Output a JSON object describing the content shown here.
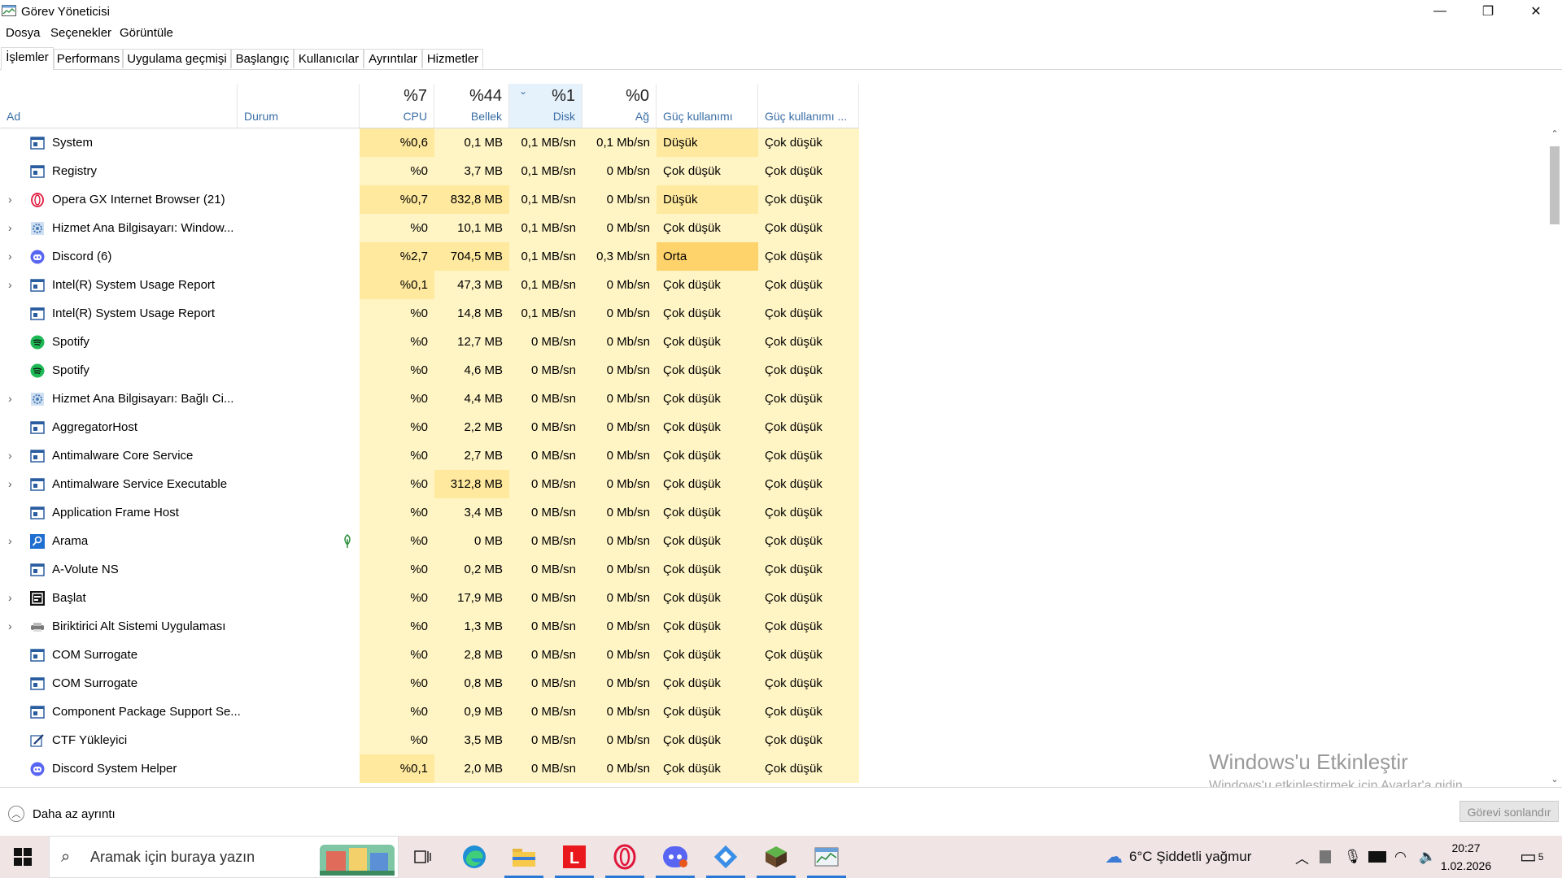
{
  "window": {
    "title": "Görev Yöneticisi",
    "controls": {
      "minimize": "—",
      "restore": "❐",
      "close": "✕"
    }
  },
  "menu": [
    "Dosya",
    "Seçenekler",
    "Görüntüle"
  ],
  "tabs": [
    "İşlemler",
    "Performans",
    "Uygulama geçmişi",
    "Başlangıç",
    "Kullanıcılar",
    "Ayrıntılar",
    "Hizmetler"
  ],
  "active_tab": "İşlemler",
  "columns": {
    "name": "Ad",
    "status": "Durum",
    "cpu": {
      "pct": "%7",
      "label": "CPU"
    },
    "memory": {
      "pct": "%44",
      "label": "Bellek"
    },
    "disk": {
      "pct": "%1",
      "label": "Disk"
    },
    "network": {
      "pct": "%0",
      "label": "Ağ"
    },
    "power": "Güç kullanımı",
    "power_trend": "Güç kullanımı ..."
  },
  "processes": [
    {
      "name": "System",
      "icon": "app-window-icon",
      "expandable": false,
      "cpu": "%0,6",
      "memory": "0,1 MB",
      "disk": "0,1 MB/sn",
      "network": "0,1 Mb/sn",
      "power": "Düşük",
      "power_trend": "Çok düşük"
    },
    {
      "name": "Registry",
      "icon": "app-window-icon",
      "expandable": false,
      "cpu": "%0",
      "memory": "3,7 MB",
      "disk": "0,1 MB/sn",
      "network": "0 Mb/sn",
      "power": "Çok düşük",
      "power_trend": "Çok düşük"
    },
    {
      "name": "Opera GX Internet Browser (21)",
      "icon": "opera-icon",
      "expandable": true,
      "cpu": "%0,7",
      "memory": "832,8 MB",
      "disk": "0,1 MB/sn",
      "network": "0 Mb/sn",
      "power": "Düşük",
      "power_trend": "Çok düşük"
    },
    {
      "name": "Hizmet Ana Bilgisayarı: Window...",
      "icon": "gear-icon",
      "expandable": true,
      "cpu": "%0",
      "memory": "10,1 MB",
      "disk": "0,1 MB/sn",
      "network": "0 Mb/sn",
      "power": "Çok düşük",
      "power_trend": "Çok düşük"
    },
    {
      "name": "Discord (6)",
      "icon": "discord-icon",
      "expandable": true,
      "cpu": "%2,7",
      "memory": "704,5 MB",
      "disk": "0,1 MB/sn",
      "network": "0,3 Mb/sn",
      "power": "Orta",
      "power_trend": "Çok düşük"
    },
    {
      "name": "Intel(R) System Usage Report",
      "icon": "app-window-icon",
      "expandable": true,
      "cpu": "%0,1",
      "memory": "47,3 MB",
      "disk": "0,1 MB/sn",
      "network": "0 Mb/sn",
      "power": "Çok düşük",
      "power_trend": "Çok düşük"
    },
    {
      "name": "Intel(R) System Usage Report",
      "icon": "app-window-icon",
      "expandable": false,
      "cpu": "%0",
      "memory": "14,8 MB",
      "disk": "0,1 MB/sn",
      "network": "0 Mb/sn",
      "power": "Çok düşük",
      "power_trend": "Çok düşük"
    },
    {
      "name": "Spotify",
      "icon": "spotify-icon",
      "expandable": false,
      "cpu": "%0",
      "memory": "12,7 MB",
      "disk": "0 MB/sn",
      "network": "0 Mb/sn",
      "power": "Çok düşük",
      "power_trend": "Çok düşük"
    },
    {
      "name": "Spotify",
      "icon": "spotify-icon",
      "expandable": false,
      "cpu": "%0",
      "memory": "4,6 MB",
      "disk": "0 MB/sn",
      "network": "0 Mb/sn",
      "power": "Çok düşük",
      "power_trend": "Çok düşük"
    },
    {
      "name": "Hizmet Ana Bilgisayarı: Bağlı Ci...",
      "icon": "gear-icon",
      "expandable": true,
      "cpu": "%0",
      "memory": "4,4 MB",
      "disk": "0 MB/sn",
      "network": "0 Mb/sn",
      "power": "Çok düşük",
      "power_trend": "Çok düşük"
    },
    {
      "name": "AggregatorHost",
      "icon": "app-window-icon",
      "expandable": false,
      "cpu": "%0",
      "memory": "2,2 MB",
      "disk": "0 MB/sn",
      "network": "0 Mb/sn",
      "power": "Çok düşük",
      "power_trend": "Çok düşük"
    },
    {
      "name": "Antimalware Core Service",
      "icon": "app-window-icon",
      "expandable": true,
      "cpu": "%0",
      "memory": "2,7 MB",
      "disk": "0 MB/sn",
      "network": "0 Mb/sn",
      "power": "Çok düşük",
      "power_trend": "Çok düşük"
    },
    {
      "name": "Antimalware Service Executable",
      "icon": "app-window-icon",
      "expandable": true,
      "cpu": "%0",
      "memory": "312,8 MB",
      "disk": "0 MB/sn",
      "network": "0 Mb/sn",
      "power": "Çok düşük",
      "power_trend": "Çok düşük"
    },
    {
      "name": "Application Frame Host",
      "icon": "app-window-icon",
      "expandable": false,
      "cpu": "%0",
      "memory": "3,4 MB",
      "disk": "0 MB/sn",
      "network": "0 Mb/sn",
      "power": "Çok düşük",
      "power_trend": "Çok düşük"
    },
    {
      "name": "Arama",
      "icon": "search-app-icon",
      "expandable": true,
      "status_icon": "leaf-icon",
      "cpu": "%0",
      "memory": "0 MB",
      "disk": "0 MB/sn",
      "network": "0 Mb/sn",
      "power": "Çok düşük",
      "power_trend": "Çok düşük"
    },
    {
      "name": "A-Volute NS",
      "icon": "app-window-icon",
      "expandable": false,
      "cpu": "%0",
      "memory": "0,2 MB",
      "disk": "0 MB/sn",
      "network": "0 Mb/sn",
      "power": "Çok düşük",
      "power_trend": "Çok düşük"
    },
    {
      "name": "Başlat",
      "icon": "start-app-icon",
      "expandable": true,
      "cpu": "%0",
      "memory": "17,9 MB",
      "disk": "0 MB/sn",
      "network": "0 Mb/sn",
      "power": "Çok düşük",
      "power_trend": "Çok düşük"
    },
    {
      "name": "Biriktirici Alt Sistemi Uygulaması",
      "icon": "printer-icon",
      "expandable": true,
      "cpu": "%0",
      "memory": "1,3 MB",
      "disk": "0 MB/sn",
      "network": "0 Mb/sn",
      "power": "Çok düşük",
      "power_trend": "Çok düşük"
    },
    {
      "name": "COM Surrogate",
      "icon": "app-window-icon",
      "expandable": false,
      "cpu": "%0",
      "memory": "2,8 MB",
      "disk": "0 MB/sn",
      "network": "0 Mb/sn",
      "power": "Çok düşük",
      "power_trend": "Çok düşük"
    },
    {
      "name": "COM Surrogate",
      "icon": "app-window-icon",
      "expandable": false,
      "cpu": "%0",
      "memory": "0,8 MB",
      "disk": "0 MB/sn",
      "network": "0 Mb/sn",
      "power": "Çok düşük",
      "power_trend": "Çok düşük"
    },
    {
      "name": "Component Package Support Se...",
      "icon": "app-window-icon",
      "expandable": false,
      "cpu": "%0",
      "memory": "0,9 MB",
      "disk": "0 MB/sn",
      "network": "0 Mb/sn",
      "power": "Çok düşük",
      "power_trend": "Çok düşük"
    },
    {
      "name": "CTF Yükleyici",
      "icon": "pen-icon",
      "expandable": false,
      "cpu": "%0",
      "memory": "3,5 MB",
      "disk": "0 MB/sn",
      "network": "0 Mb/sn",
      "power": "Çok düşük",
      "power_trend": "Çok düşük"
    },
    {
      "name": "Discord System Helper",
      "icon": "discord-icon",
      "expandable": false,
      "cpu": "%0,1",
      "memory": "2,0 MB",
      "disk": "0 MB/sn",
      "network": "0 Mb/sn",
      "power": "Çok düşük",
      "power_trend": "Çok düşük"
    }
  ],
  "footer": {
    "less_details": "Daha az ayrıntı",
    "end_task": "Görevi sonlandır"
  },
  "watermark": {
    "title": "Windows'u Etkinleştir",
    "subtitle": "Windows'u etkinleştirmek için Ayarlar'a gidin."
  },
  "taskbar": {
    "search_placeholder": "Aramak için buraya yazın",
    "apps": [
      "task-view-icon",
      "edge-icon",
      "file-explorer-icon",
      "lichess-icon",
      "opera-gx-icon",
      "discord-icon",
      "ms-teams-icon",
      "minecraft-icon",
      "task-manager-icon"
    ],
    "weather": "6°C  Şiddetli yağmur",
    "time": "20:27",
    "date": "1.02.2026",
    "notifications": "5"
  },
  "colors": {
    "heat_light": "#fff4c4",
    "heat_mid": "#ffe99e",
    "heat_orange": "#ffd36b",
    "sort_header": "#e5f1fb",
    "link_blue": "#3a6ea5"
  }
}
